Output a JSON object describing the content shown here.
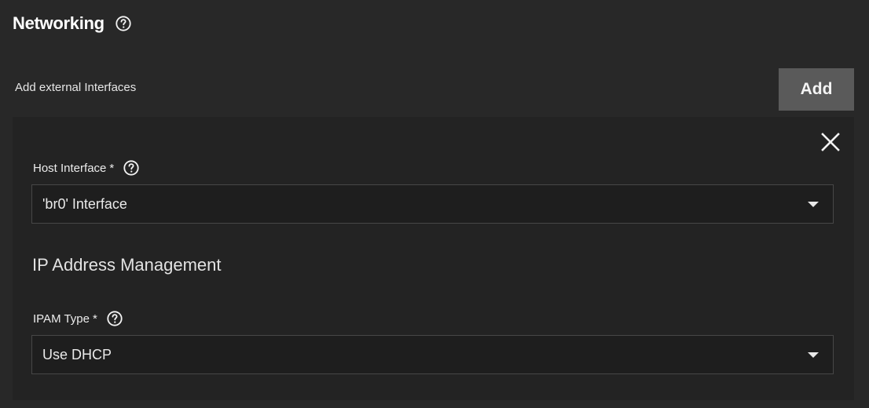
{
  "networking": {
    "title": "Networking",
    "help_icon": "help-circle-icon"
  },
  "external_interfaces": {
    "label": "Add external Interfaces",
    "add_label": "Add"
  },
  "interface_card": {
    "close_icon": "close-icon",
    "host_interface": {
      "label": "Host Interface",
      "required_marker": "*",
      "help_icon": "help-circle-icon",
      "value": "'br0' Interface",
      "dropdown_icon": "caret-down-icon"
    },
    "ipam_section_title": "IP Address Management",
    "ipam_type": {
      "label": "IPAM Type",
      "required_marker": "*",
      "help_icon": "help-circle-icon",
      "value": "Use DHCP",
      "dropdown_icon": "caret-down-icon"
    }
  },
  "colors": {
    "background": "#282828",
    "card": "#232323",
    "input_background": "#1e1e1e",
    "input_border": "#474747",
    "button": "#5a5a5a",
    "text": "#e9e9e9"
  }
}
